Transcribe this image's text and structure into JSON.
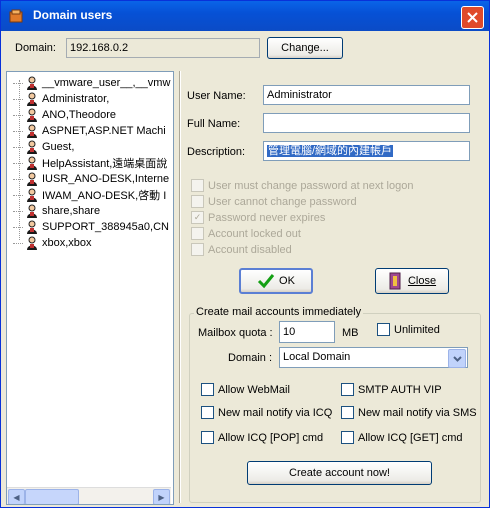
{
  "window": {
    "title": "Domain users",
    "colors": {
      "title_bar": "#0A64E8",
      "close": "#E04A2A"
    }
  },
  "domain": {
    "label": "Domain:",
    "value": "192.168.0.2",
    "change_label": "Change..."
  },
  "users": [
    "__vmware_user__,__vmw",
    "Administrator,",
    "ANO,Theodore",
    "ASPNET,ASP.NET Machi",
    "Guest,",
    "HelpAssistant,遠端桌面說",
    "IUSR_ANO-DESK,Interne",
    "IWAM_ANO-DESK,啓動 I",
    "share,share",
    "SUPPORT_388945a0,CN",
    "xbox,xbox"
  ],
  "form": {
    "user_name_label": "User Name:",
    "user_name_value": "Administrator",
    "full_name_label": "Full Name:",
    "full_name_value": "",
    "description_label": "Description:",
    "description_value": "管理電腦/網域的內建帳戶"
  },
  "options": [
    {
      "label": "User must change password at next logon",
      "checked": false
    },
    {
      "label": "User cannot change password",
      "checked": false
    },
    {
      "label": "Password never expires",
      "checked": true
    },
    {
      "label": "Account locked out",
      "checked": false
    },
    {
      "label": "Account disabled",
      "checked": false
    }
  ],
  "buttons": {
    "ok": "OK",
    "close": "Close"
  },
  "mail": {
    "group_title": "Create mail accounts immediately",
    "quota_label": "Mailbox quota :",
    "quota_value": "10",
    "quota_unit": "MB",
    "unlimited_label": "Unlimited",
    "domain_label": "Domain :",
    "domain_value": "Local Domain",
    "allow_webmail": "Allow WebMail",
    "smtp_auth": "SMTP AUTH VIP",
    "notify_icq": "New mail notify via ICQ",
    "notify_sms": "New mail notify via SMS",
    "allow_icq_pop": "Allow ICQ [POP]  cmd",
    "allow_icq_get": "Allow ICQ [GET]  cmd",
    "create_label": "Create account now!"
  }
}
